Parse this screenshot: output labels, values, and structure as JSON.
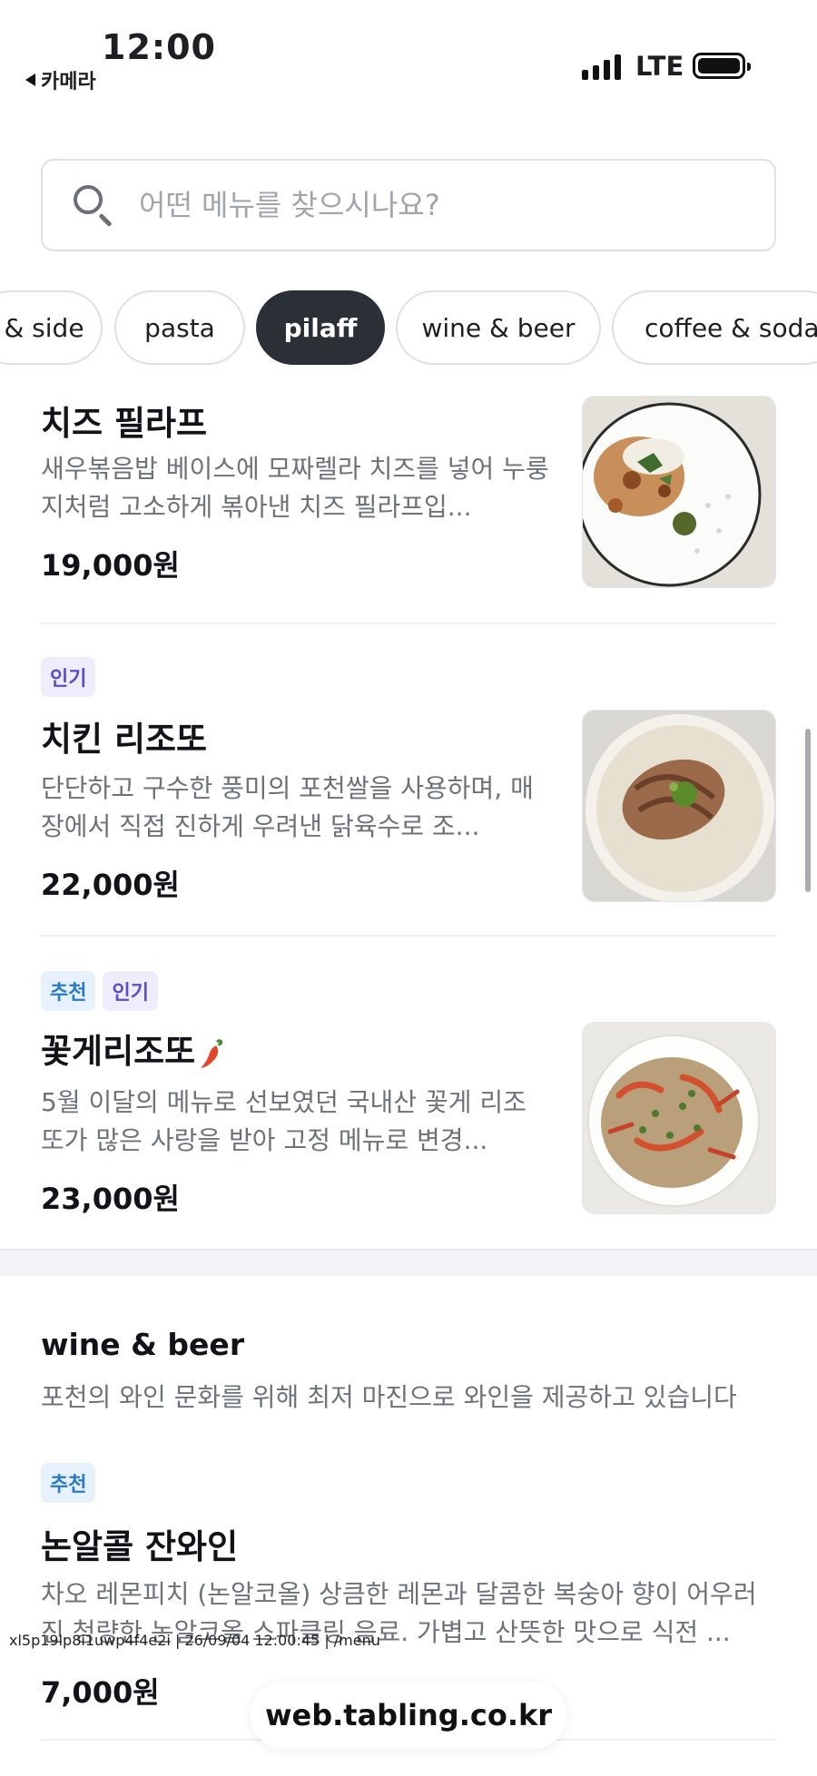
{
  "status_bar": {
    "time": "12:00",
    "back_label": "카메라",
    "network": "LTE"
  },
  "search": {
    "placeholder": "어떤 메뉴를 찾으시나요?",
    "icon": "search-icon"
  },
  "categories": [
    {
      "label": "& side",
      "active": false
    },
    {
      "label": "pasta",
      "active": false
    },
    {
      "label": "pilaff",
      "active": true
    },
    {
      "label": "wine & beer",
      "active": false
    },
    {
      "label": "coffee & soda",
      "active": false
    }
  ],
  "items": [
    {
      "name": "치즈 필라프",
      "tags": [],
      "desc": "새우볶음밥 베이스에 모짜렐라 치즈를 넣어 누룽지처럼 고소하게 볶아낸 치즈 필라프입...",
      "price": "19,000원"
    },
    {
      "name": "치킨 리조또",
      "tags": [
        "인기"
      ],
      "desc": "단단하고 구수한 풍미의 포천쌀을 사용하며, 매장에서 직접 진하게 우려낸 닭육수로 조...",
      "price": "22,000원"
    },
    {
      "name": "꽃게리조또",
      "tags": [
        "추천",
        "인기"
      ],
      "spicy": true,
      "desc": "5월 이달의 메뉴로 선보였던 국내산 꽃게 리조또가 많은 사랑을 받아 고정 메뉴로 변경...",
      "price": "23,000원"
    }
  ],
  "wine_section": {
    "title": "wine & beer",
    "desc": "포천의 와인 문화를 위해 최저 마진으로 와인을 제공하고 있습니다",
    "item": {
      "name": "논알콜 잔와인",
      "tags": [
        "추천"
      ],
      "desc": "차오 레몬피치 (논알코올) 상큼한 레몬과 달콤한 복숭아 향이 어우러진 청량한 논알코올 스파클링 음료. 가볍고 산뜻한 맛으로 식전 ...",
      "price": "7,000원"
    }
  },
  "overlay": {
    "stamp": "xl5p19lp8i1uwp4f4e2i | 26/09/04 12:00:45 | /menu",
    "url": "web.tabling.co.kr"
  }
}
